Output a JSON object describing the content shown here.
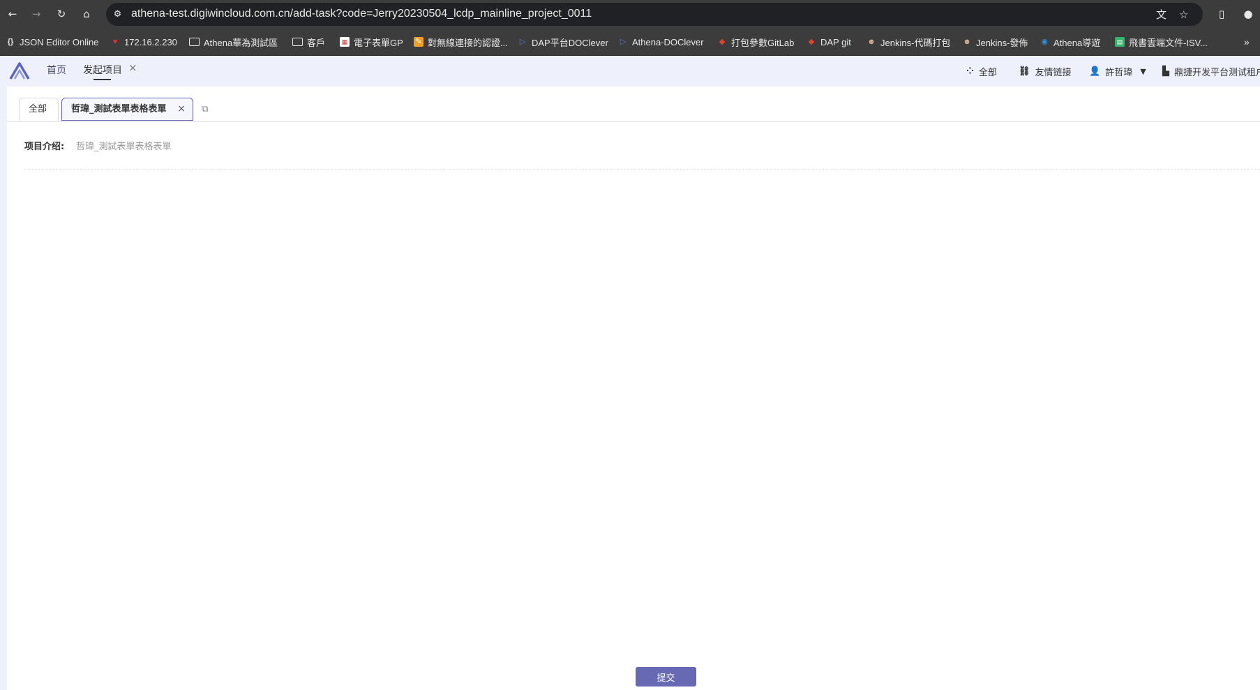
{
  "browser": {
    "url": "athena-test.digiwincloud.com.cn/add-task?code=Jerry20230504_lcdp_mainline_project_0011",
    "bookmarks": [
      {
        "label": "JSON Editor Online",
        "icon": "braces-icon",
        "color": "#e8e8e8"
      },
      {
        "label": "172.16.2.230",
        "icon": "shield-icon",
        "color": "#e03030"
      },
      {
        "label": "Athena華為測試區",
        "icon": "folder-icon",
        "color": "#e8e8e8"
      },
      {
        "label": "客戶",
        "icon": "folder-icon",
        "color": "#e8e8e8"
      },
      {
        "label": "電子表單GP",
        "icon": "form-icon",
        "color": "#ffffff"
      },
      {
        "label": "對無線連接的認證...",
        "icon": "pen-icon",
        "color": "#f0a020"
      },
      {
        "label": "DAP平台DOClever",
        "icon": "doclever-icon",
        "color": "#5b7bd5"
      },
      {
        "label": "Athena-DOClever",
        "icon": "doclever-icon",
        "color": "#5b7bd5"
      },
      {
        "label": "打包參數GitLab",
        "icon": "gitlab-icon",
        "color": "#e24329"
      },
      {
        "label": "DAP git",
        "icon": "gitlab-icon",
        "color": "#e24329"
      },
      {
        "label": "Jenkins-代碼打包",
        "icon": "jenkins-icon",
        "color": "#d8b090"
      },
      {
        "label": "Jenkins-發佈",
        "icon": "jenkins-icon",
        "color": "#d8b090"
      },
      {
        "label": "Athena導遊",
        "icon": "globe-icon",
        "color": "#2f8fe0"
      },
      {
        "label": "飛書雲端文件-ISV...",
        "icon": "sheet-icon",
        "color": "#34b36b"
      }
    ]
  },
  "header": {
    "tabs": [
      {
        "label": "首页"
      },
      {
        "label": "发起项目"
      }
    ],
    "right": {
      "all": "全部",
      "links": "友情链接",
      "user": "許哲瑋",
      "tenant": "鼎捷开发平台测试租户"
    }
  },
  "page": {
    "tabs": {
      "all": "全部",
      "current": "哲瑋_測試表單表格表單"
    },
    "intro": {
      "label": "项目介绍:",
      "value": "哲瑋_測試表單表格表單"
    },
    "submit": "提交"
  },
  "colors": {
    "accent": "#6869b3",
    "header_bg": "#eef1fb",
    "chrome_bg": "#3c3c3c"
  }
}
